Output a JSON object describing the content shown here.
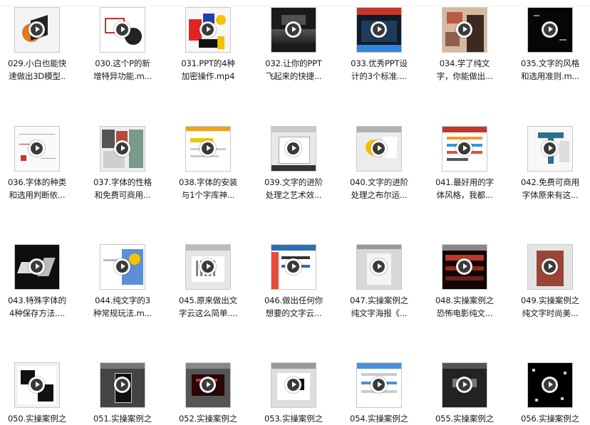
{
  "window": {
    "title": ""
  },
  "files": [
    {
      "name": "029.小白也能快速做出3D模型..",
      "line1": "029.小白也能快",
      "line2": "速做出3D模型..",
      "thumb": "3d-model",
      "col": 0,
      "row": 0
    },
    {
      "name": "030.这个P的新增特异功能.m...",
      "line1": "030.这个P的新",
      "line2": "增特异功能.m...",
      "thumb": "presenter",
      "col": 1,
      "row": 0
    },
    {
      "name": "031.PPT的4种加密操作.mp4",
      "line1": "031.PPT的4种",
      "line2": "加密操作.mp4",
      "thumb": "color-blocks",
      "col": 2,
      "row": 0
    },
    {
      "name": "032.让你的PPT飞起来的快捷...",
      "line1": "032.让你的PPT",
      "line2": "飞起来的快捷...",
      "thumb": "dark-scene",
      "col": 3,
      "row": 0
    },
    {
      "name": "033.优秀PPT设计的3个标准....",
      "line1": "033.优秀PPT设",
      "line2": "计的3个标准....",
      "thumb": "dark-ui",
      "col": 4,
      "row": 0
    },
    {
      "name": "034.学了纯文字，你能做出...",
      "line1": "034.学了纯文",
      "line2": "字，你能做出...",
      "thumb": "poster-person",
      "col": 5,
      "row": 0
    },
    {
      "name": "035.文字的风格和选用准则.m...",
      "line1": "035.文字的风格",
      "line2": "和选用准则.m...",
      "thumb": "black-text",
      "col": 6,
      "row": 0
    },
    {
      "name": "036.字体的种类和选用判断依...",
      "line1": "036.字体的种类",
      "line2": "和选用判断依...",
      "thumb": "mindmap",
      "col": 0,
      "row": 1
    },
    {
      "name": "037.字体的性格和免费可商用...",
      "line1": "037.字体的性格",
      "line2": "和免费可商用...",
      "thumb": "posters",
      "col": 1,
      "row": 1
    },
    {
      "name": "038.字体的安装与1个字库神...",
      "line1": "038.字体的安装",
      "line2": "与1个字库神...",
      "thumb": "website",
      "col": 2,
      "row": 1
    },
    {
      "name": "039.文字的进阶处理之艺术效...",
      "line1": "039.文字的进阶",
      "line2": "处理之艺术效...",
      "thumb": "ppt-editor",
      "col": 3,
      "row": 1
    },
    {
      "name": "040.文字的进阶处理之布尔运...",
      "line1": "040.文字的进阶",
      "line2": "处理之布尔运...",
      "thumb": "ppt-yellow",
      "col": 4,
      "row": 1
    },
    {
      "name": "041.最好用的字体风格，我都...",
      "line1": "041.最好用的字",
      "line2": "体风格，我都...",
      "thumb": "font-list",
      "col": 5,
      "row": 1
    },
    {
      "name": "042.免费可商用字体原来有这...",
      "line1": "042.免费可商用",
      "line2": "字体原来有这...",
      "thumb": "font-t",
      "col": 6,
      "row": 1
    },
    {
      "name": "043.特殊字体的4种保存方法....",
      "line1": "043.特殊字体的",
      "line2": "4种保存方法....",
      "thumb": "brush-text",
      "col": 0,
      "row": 2
    },
    {
      "name": "044.纯文字的3种常规玩法.m...",
      "line1": "044.纯文字的3",
      "line2": "种常规玩法.m...",
      "thumb": "blue-slide",
      "col": 1,
      "row": 2
    },
    {
      "name": "045.原来做出文字云这么简单....",
      "line1": "045.原来做出文",
      "line2": "字云这么简单....",
      "thumb": "word-cloud",
      "col": 2,
      "row": 2
    },
    {
      "name": "046.做出任何你想要的文字云...",
      "line1": "046.做出任何你",
      "line2": "想要的文字云...",
      "thumb": "input-web",
      "col": 3,
      "row": 2
    },
    {
      "name": "047.实操案例之纯文字海报《...",
      "line1": "047.实操案例之",
      "line2": "纯文字海报《...",
      "thumb": "gray-poster",
      "col": 4,
      "row": 2
    },
    {
      "name": "048.实操案例之恐怖电影纯文...",
      "line1": "048.实操案例之",
      "line2": "恐怖电影纯文...",
      "thumb": "horror",
      "col": 5,
      "row": 2
    },
    {
      "name": "049.实操案例之纯文字时尚美...",
      "line1": "049.实操案例之",
      "line2": "纯文字时尚美...",
      "thumb": "fashion",
      "col": 6,
      "row": 2
    },
    {
      "name": "050.实操案例之...",
      "line1": "050.实操案例之",
      "line2": "",
      "thumb": "calligraphy",
      "col": 0,
      "row": 3
    },
    {
      "name": "051.实操案例之...",
      "line1": "051.实操案例之",
      "line2": "",
      "thumb": "dark-editor",
      "col": 1,
      "row": 3
    },
    {
      "name": "052.实操案例之...",
      "line1": "052.实操案例之",
      "line2": "",
      "thumb": "red-editor",
      "col": 2,
      "row": 3
    },
    {
      "name": "053.实操案例之...",
      "line1": "053.实操案例之",
      "line2": "",
      "thumb": "ink-editor",
      "col": 3,
      "row": 3
    },
    {
      "name": "054.实操案例之...",
      "line1": "054.实操案例之",
      "line2": "",
      "thumb": "blue-web",
      "col": 4,
      "row": 3
    },
    {
      "name": "055.实操案例之...",
      "line1": "055.实操案例之",
      "line2": "",
      "thumb": "dark-title",
      "col": 5,
      "row": 3
    },
    {
      "name": "056.实操案例之...",
      "line1": "056.实操案例之",
      "line2": "",
      "thumb": "star-text",
      "col": 6,
      "row": 3
    }
  ]
}
